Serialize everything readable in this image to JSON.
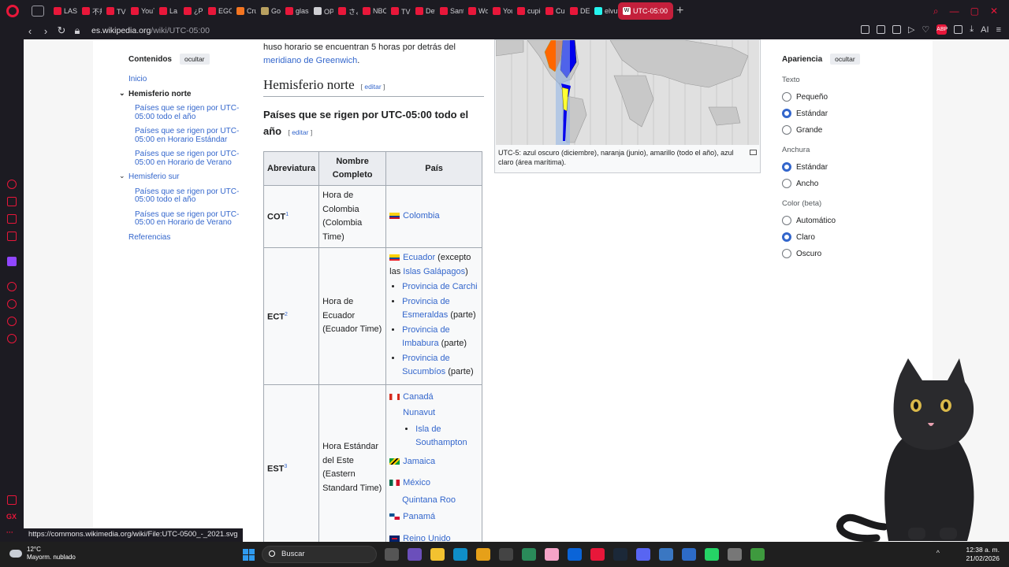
{
  "browser": {
    "tabs": [
      {
        "label": "LAS",
        "color": "#e8173a"
      },
      {
        "label": "不規",
        "color": "#e8173a"
      },
      {
        "label": "TVア",
        "color": "#e8173a"
      },
      {
        "label": "YouT",
        "color": "#e8173a"
      },
      {
        "label": "La Bu",
        "color": "#e8173a"
      },
      {
        "label": "¿Pue",
        "color": "#e8173a"
      },
      {
        "label": "EGOI",
        "color": "#e8173a"
      },
      {
        "label": "Crunc",
        "color": "#f47521"
      },
      {
        "label": "Golde",
        "color": "#b8a060"
      },
      {
        "label": "glass",
        "color": "#e8173a"
      },
      {
        "label": "OP剣",
        "color": "#cfcfd4"
      },
      {
        "label": "さよな",
        "color": "#e8173a"
      },
      {
        "label": "NBC",
        "color": "#e8173a"
      },
      {
        "label": "TVア",
        "color": "#e8173a"
      },
      {
        "label": "Detal",
        "color": "#e8173a"
      },
      {
        "label": "Santi",
        "color": "#e8173a"
      },
      {
        "label": "World",
        "color": "#e8173a"
      },
      {
        "label": "YouT",
        "color": "#e8173a"
      },
      {
        "label": "cupid",
        "color": "#e8173a"
      },
      {
        "label": "Cupic",
        "color": "#e8173a"
      },
      {
        "label": "DESG",
        "color": "#e8173a"
      },
      {
        "label": "elvuti",
        "color": "#25f4ee"
      }
    ],
    "active_tab": "UTC-05:00",
    "url_host": "es.wikipedia.org",
    "url_path": "/wiki/UTC-05:00",
    "ai_label": "AI"
  },
  "toc": {
    "title": "Contenidos",
    "hide": "ocultar",
    "items": [
      {
        "label": "Inicio",
        "kind": "link"
      },
      {
        "label": "Hemisferio norte",
        "kind": "section"
      },
      {
        "label": "Países que se rigen por UTC-05:00 todo el año",
        "kind": "sub"
      },
      {
        "label": "Países que se rigen por UTC-05:00 en Horario Estándar",
        "kind": "sub"
      },
      {
        "label": "Países que se rigen por UTC-05:00 en Horario de Verano",
        "kind": "sub"
      },
      {
        "label": "Hemisferio sur",
        "kind": "section2"
      },
      {
        "label": "Países que se rigen por UTC-05:00 todo el año",
        "kind": "sub"
      },
      {
        "label": "Países que se rigen por UTC-05:00 en Horario de Verano",
        "kind": "sub"
      },
      {
        "label": "Referencias",
        "kind": "link"
      }
    ]
  },
  "content": {
    "intro_text": "huso horario se encuentran 5 horas por detrás del",
    "intro_link": "meridiano de Greenwich",
    "h2": "Hemisferio norte",
    "edit": "editar",
    "h3": "Países que se rigen por UTC-05:00 todo el año",
    "table": {
      "headers": [
        "Abreviatura",
        "Nombre Completo",
        "País"
      ],
      "cot": {
        "abbr": "COT",
        "ref": "1",
        "name": "Hora de Colombia (Colombia Time)",
        "country": "Colombia"
      },
      "ect": {
        "abbr": "ECT",
        "ref": "2",
        "name": "Hora de Ecuador (Ecuador Time)",
        "country": "Ecuador",
        "country_note": " (excepto las ",
        "galapagos": "Islas Galápagos",
        "close": ")",
        "provinces": [
          {
            "name": "Provincia de Carchi",
            "note": ""
          },
          {
            "name": "Provincia de Esmeraldas",
            "note": " (parte)"
          },
          {
            "name": "Provincia de Imbabura",
            "note": " (parte)"
          },
          {
            "name": "Provincia de Sucumbíos",
            "note": " (parte)"
          }
        ]
      },
      "est": {
        "abbr": "EST",
        "ref": "3",
        "name": "Hora Estándar del Este (Eastern Standard Time)",
        "canada": "Canadá",
        "nunavut": "Nunavut",
        "southampton": "Isla de Southampton",
        "jamaica": "Jamaica",
        "mexico": "México",
        "qroo": "Quintana Roo",
        "panama": "Panamá",
        "uk": "Reino Unido"
      }
    }
  },
  "map": {
    "caption": "UTC-5: azul oscuro (diciembre), naranja (junio), amarillo (todo el año), azul claro (área marítima)."
  },
  "appearance": {
    "title": "Apariencia",
    "hide": "ocultar",
    "text_label": "Texto",
    "text_options": [
      "Pequeño",
      "Estándar",
      "Grande"
    ],
    "text_selected": "Estándar",
    "width_label": "Anchura",
    "width_options": [
      "Estándar",
      "Ancho"
    ],
    "width_selected": "Estándar",
    "color_label": "Color (beta)",
    "color_options": [
      "Automático",
      "Claro",
      "Oscuro"
    ],
    "color_selected": "Claro"
  },
  "status_url": "https://commons.wikimedia.org/wiki/File:UTC-0500_-_2021.svg",
  "taskbar": {
    "temp": "12°C",
    "weather": "Mayorm. nublado",
    "search": "Buscar",
    "time": "12:38 a. m.",
    "date": "21/02/2026"
  }
}
